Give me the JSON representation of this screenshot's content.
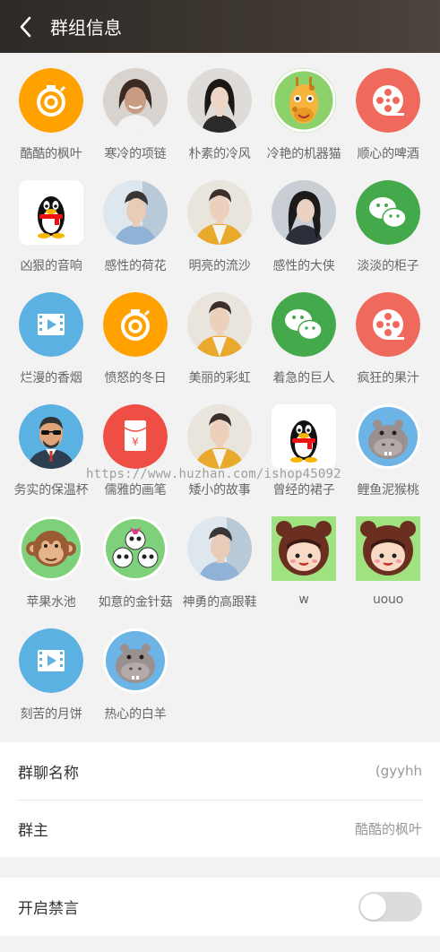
{
  "header": {
    "title": "群组信息"
  },
  "members": [
    {
      "name": "酷酷的枫叶",
      "avatar": "camera-shutter-icon",
      "bg": "#ffa200"
    },
    {
      "name": "寒冷的项链",
      "avatar": "photo-woman-smiling",
      "bg": "#cfc9c4"
    },
    {
      "name": "朴素的冷风",
      "avatar": "photo-woman-dark-hair",
      "bg": "#d9d6d3"
    },
    {
      "name": "冷艳的机器猫",
      "avatar": "giraffe-icon",
      "bg": "#8cd16a"
    },
    {
      "name": "顺心的啤酒",
      "avatar": "film-reel-icon",
      "bg": "#ef6a5c"
    },
    {
      "name": "凶狠的音响",
      "avatar": "qq-penguin-icon",
      "bg": "#ffffff"
    },
    {
      "name": "感性的荷花",
      "avatar": "photo-man-blue",
      "bg": "#c9d7e3"
    },
    {
      "name": "明亮的流沙",
      "avatar": "photo-man-yellow-jacket",
      "bg": "#e2dbd0"
    },
    {
      "name": "感性的大侠",
      "avatar": "photo-woman-long-hair",
      "bg": "#c8ccd3"
    },
    {
      "name": "淡淡的柜子",
      "avatar": "wechat-icon",
      "bg": "#44a94a"
    },
    {
      "name": "烂漫的香烟",
      "avatar": "video-icon",
      "bg": "#5bb2e2"
    },
    {
      "name": "愤怒的冬日",
      "avatar": "camera-shutter-icon",
      "bg": "#ffa200"
    },
    {
      "name": "美丽的彩虹",
      "avatar": "photo-man-yellow-jacket",
      "bg": "#e2dbd0"
    },
    {
      "name": "着急的巨人",
      "avatar": "wechat-icon",
      "bg": "#44a94a"
    },
    {
      "name": "疯狂的果汁",
      "avatar": "film-reel-icon",
      "bg": "#ef6a5c"
    },
    {
      "name": "务实的保温杯",
      "avatar": "man-sunglasses-icon",
      "bg": "#5bb2e2"
    },
    {
      "name": "儒雅的画笔",
      "avatar": "red-envelope-icon",
      "bg": "#ef4e45"
    },
    {
      "name": "矮小的故事",
      "avatar": "photo-man-yellow-jacket",
      "bg": "#e2dbd0"
    },
    {
      "name": "曾经的裙子",
      "avatar": "qq-penguin-icon",
      "bg": "#ffffff"
    },
    {
      "name": "鲤鱼泥猴桃",
      "avatar": "hippo-icon",
      "bg": "#6cb3e6"
    },
    {
      "name": "苹果水池",
      "avatar": "monkey-icon",
      "bg": "#7ed07a"
    },
    {
      "name": "如意的金针菇",
      "avatar": "panda-icon",
      "bg": "#7ed07a"
    },
    {
      "name": "神勇的高跟鞋",
      "avatar": "photo-man-blue",
      "bg": "#c9d7e3"
    },
    {
      "name": "w",
      "avatar": "bear-girl-icon",
      "bg": "#9fe27f"
    },
    {
      "name": "uouo",
      "avatar": "bear-girl-icon",
      "bg": "#9fe27f"
    },
    {
      "name": "刻苦的月饼",
      "avatar": "video-icon",
      "bg": "#5bb2e2"
    },
    {
      "name": "热心的白羊",
      "avatar": "hippo-icon",
      "bg": "#6cb3e6"
    }
  ],
  "watermark": "https://www.huzhan.com/ishop45092",
  "settings": {
    "group_name_label": "群聊名称",
    "group_name_value": "(gyyhh",
    "owner_label": "群主",
    "owner_value": "酷酷的枫叶",
    "mute_label": "开启禁言",
    "mute_on": false
  }
}
